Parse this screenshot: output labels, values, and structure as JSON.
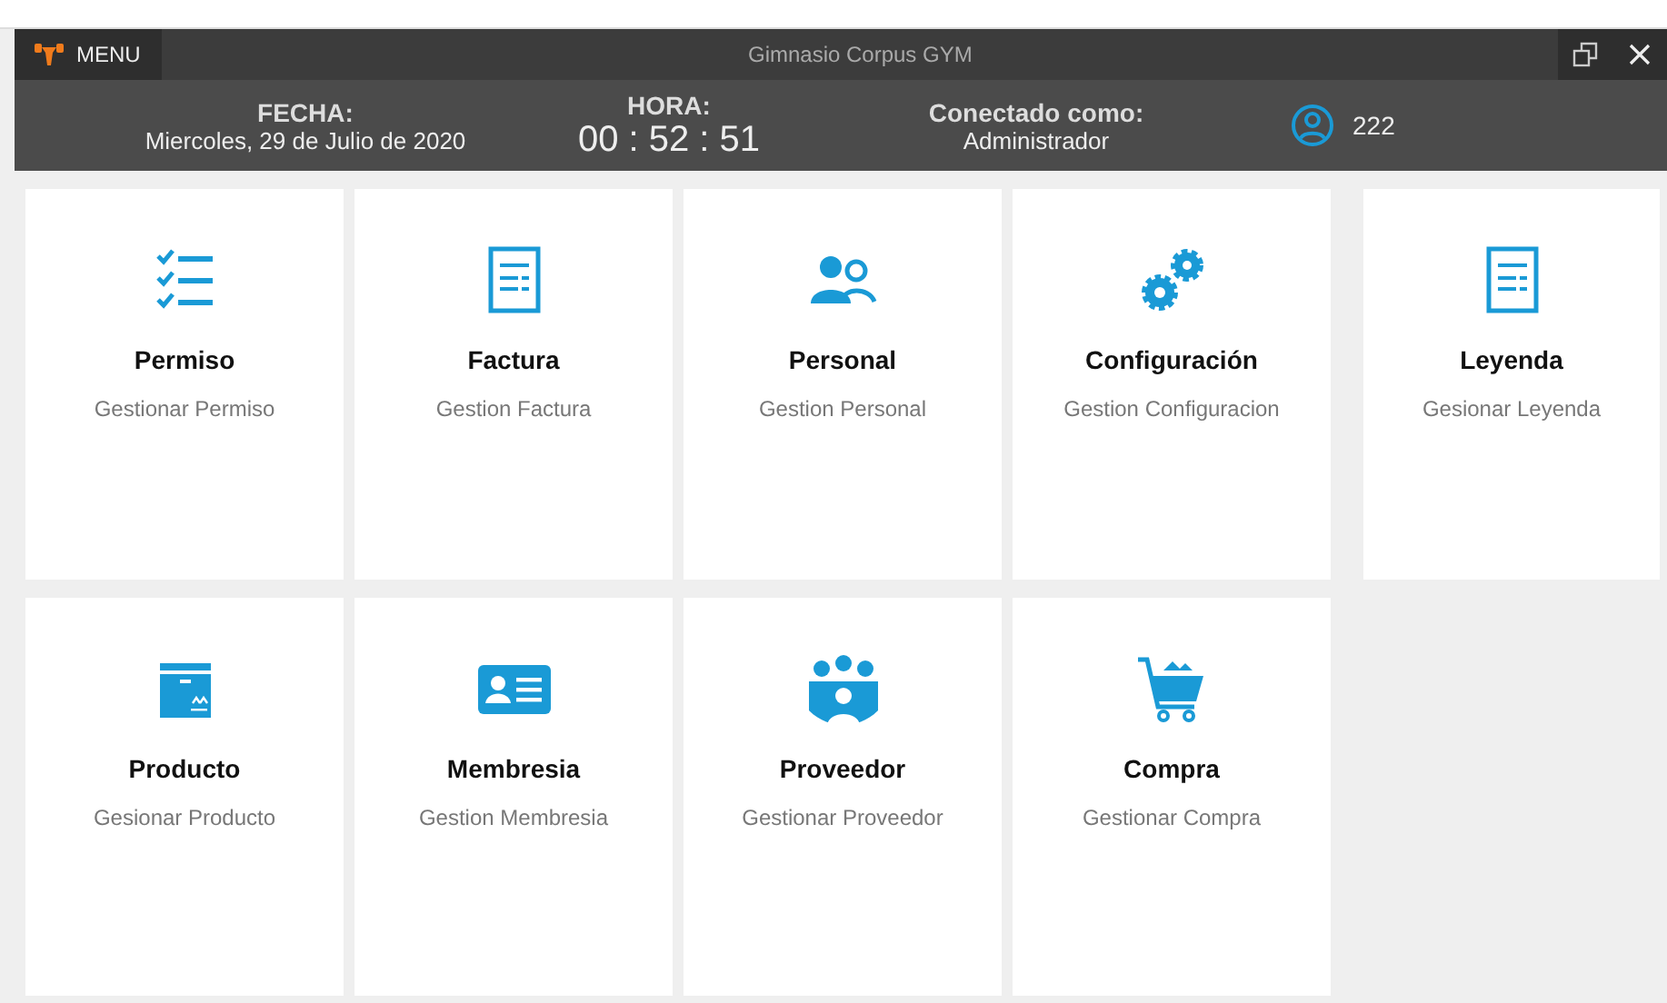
{
  "window": {
    "menu_label": "MENU",
    "title": "Gimnasio Corpus GYM"
  },
  "header": {
    "date_label": "FECHA:",
    "date": "Miercoles, 29 de Julio de 2020",
    "time_label": "HORA:",
    "time": "00 : 52 : 51",
    "user_label": "Conectado como:",
    "user_role": "Administrador",
    "user_name": "222"
  },
  "modules": [
    {
      "kind": "checklist",
      "title": "Permiso",
      "subtitle": "Gestionar Permiso"
    },
    {
      "kind": "document",
      "title": "Factura",
      "subtitle": "Gestion Factura"
    },
    {
      "kind": "people",
      "title": "Personal",
      "subtitle": "Gestion Personal"
    },
    {
      "kind": "gears",
      "title": "Configuración",
      "subtitle": "Gestion Configuracion"
    },
    {
      "kind": "document",
      "title": "Leyenda",
      "subtitle": "Gesionar Leyenda"
    },
    {
      "kind": "box",
      "title": "Producto",
      "subtitle": "Gesionar Producto"
    },
    {
      "kind": "idcard",
      "title": "Membresia",
      "subtitle": "Gestion Membresia"
    },
    {
      "kind": "group",
      "title": "Proveedor",
      "subtitle": "Gestionar Proveedor"
    },
    {
      "kind": "cart",
      "title": "Compra",
      "subtitle": "Gestionar Compra"
    }
  ]
}
